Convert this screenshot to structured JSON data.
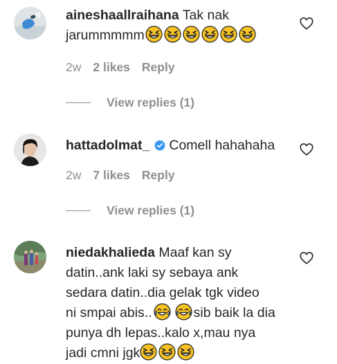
{
  "comments": [
    {
      "username": "aineshaallraihana",
      "text_line1": "Tak nak",
      "text_line2": "jarummmmm",
      "emoji_count": 6,
      "emoji_name": "grinning-squinting-face",
      "age": "2w",
      "likes": "2 likes",
      "reply_label": "Reply",
      "view_replies": "View replies (1)"
    },
    {
      "username": "hattadolmat_",
      "verified": true,
      "text": "Comell hahahaha",
      "age": "2w",
      "likes": "7 likes",
      "reply_label": "Reply",
      "view_replies": "View replies (1)"
    },
    {
      "username": "niedakhalieda",
      "text_line1": "Maaf kan sy",
      "text_line2": "datin..ank laki sy sebaya ank",
      "text_line3": "sedara datin..dia gelak tgk video",
      "text_line4a": "ni smpai abis..",
      "text_line4b": "sib baik la dia",
      "text_line5": "punya dh lepas..kalo x,mau nya",
      "text_line6": "jadi cmni jgk",
      "emojis_line4": [
        "face-with-tears-of-joy",
        "face-with-tears-of-joy"
      ],
      "emojis_line6": [
        "grinning-squinting-face",
        "grinning-squinting-face",
        "grinning-squinting-face"
      ]
    }
  ],
  "colors": {
    "text": "#262626",
    "secondary": "#8e8e8e",
    "verified": "#3897f0",
    "emoji": "#f7c325"
  }
}
